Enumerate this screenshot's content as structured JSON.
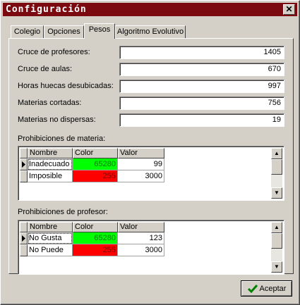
{
  "window": {
    "title": "Configuración",
    "close_glyph": "✕"
  },
  "tabs": [
    {
      "label": "Colegio"
    },
    {
      "label": "Opciones"
    },
    {
      "label": "Pesos",
      "active": true
    },
    {
      "label": "Algoritmo Evolutivo"
    }
  ],
  "fields": [
    {
      "label": "Cruce de profesores:",
      "value": "1405"
    },
    {
      "label": "Cruce de aulas:",
      "value": "670"
    },
    {
      "label": "Horas huecas desubicadas:",
      "value": "997"
    },
    {
      "label": "Materias cortadas:",
      "value": "756"
    },
    {
      "label": "Materias no dispersas:",
      "value": "19"
    }
  ],
  "grid_materia": {
    "title": "Prohibiciones de materia:",
    "columns": [
      "Nombre",
      "Color",
      "Valor"
    ],
    "rows": [
      {
        "nombre": "Inadecuado",
        "color_value": "65280",
        "color_hex": "#00ff00",
        "valor": "99"
      },
      {
        "nombre": "Imposible",
        "color_value": "255",
        "color_hex": "#ff0000",
        "valor": "3000"
      }
    ]
  },
  "grid_profesor": {
    "title": "Prohibiciones de profesor:",
    "columns": [
      "Nombre",
      "Color",
      "Valor"
    ],
    "rows": [
      {
        "nombre": "No Gusta",
        "color_value": "65280",
        "color_hex": "#00ff00",
        "valor": "123"
      },
      {
        "nombre": "No Puede",
        "color_value": "255",
        "color_hex": "#ff0000",
        "valor": "3000"
      }
    ]
  },
  "buttons": {
    "accept_label": "Aceptar"
  },
  "colors": {
    "title_bar": "#7a0a10",
    "face": "#d4d0c8"
  }
}
